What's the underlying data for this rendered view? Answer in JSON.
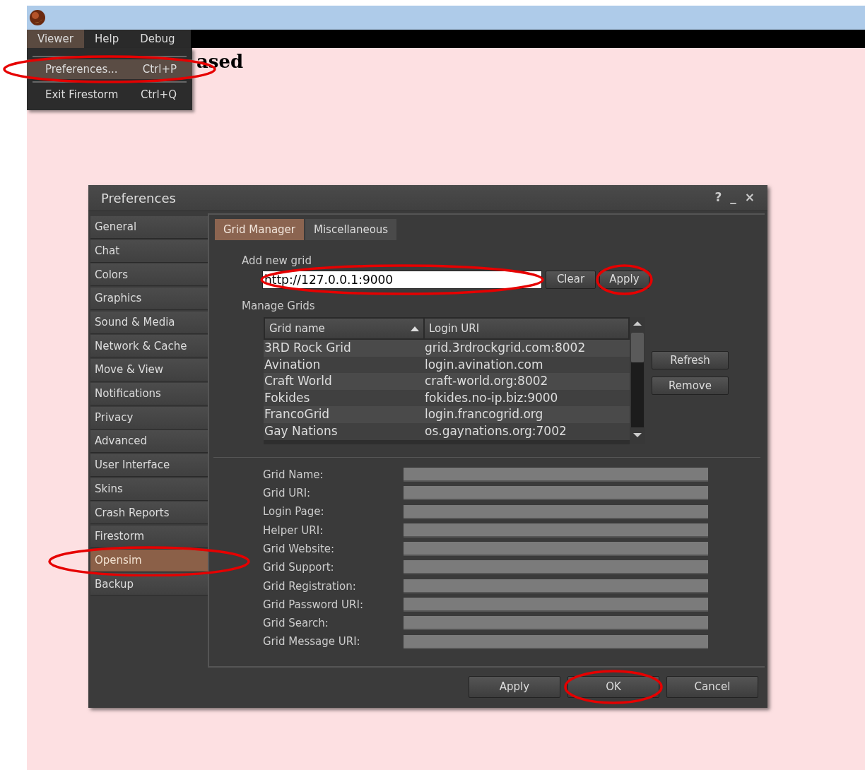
{
  "menu_bar": {
    "items": [
      {
        "label": "Viewer",
        "selected": true
      },
      {
        "label": "Help",
        "selected": false
      },
      {
        "label": "Debug",
        "selected": false
      }
    ]
  },
  "menu": {
    "items": [
      {
        "label": "Preferences...",
        "shortcut": "Ctrl+P",
        "selected": true,
        "circled": true
      },
      {
        "label": "Exit Firestorm",
        "shortcut": "Ctrl+Q",
        "selected": false,
        "circled": false
      }
    ]
  },
  "background_heading": "ased",
  "window": {
    "title": "Preferences",
    "title_buttons": [
      "?",
      "_",
      "×"
    ]
  },
  "sidebar": {
    "items": [
      {
        "label": "General",
        "selected": false,
        "circled": false
      },
      {
        "label": "Chat",
        "selected": false,
        "circled": false
      },
      {
        "label": "Colors",
        "selected": false,
        "circled": false
      },
      {
        "label": "Graphics",
        "selected": false,
        "circled": false
      },
      {
        "label": "Sound & Media",
        "selected": false,
        "circled": false
      },
      {
        "label": "Network & Cache",
        "selected": false,
        "circled": false
      },
      {
        "label": "Move & View",
        "selected": false,
        "circled": false
      },
      {
        "label": "Notifications",
        "selected": false,
        "circled": false
      },
      {
        "label": "Privacy",
        "selected": false,
        "circled": false
      },
      {
        "label": "Advanced",
        "selected": false,
        "circled": false
      },
      {
        "label": "User Interface",
        "selected": false,
        "circled": false
      },
      {
        "label": "Skins",
        "selected": false,
        "circled": false
      },
      {
        "label": "Crash Reports",
        "selected": false,
        "circled": false
      },
      {
        "label": "Firestorm",
        "selected": false,
        "circled": false
      },
      {
        "label": "Opensim",
        "selected": true,
        "circled": true
      },
      {
        "label": "Backup",
        "selected": false,
        "circled": false
      }
    ]
  },
  "tabs": [
    {
      "label": "Grid Manager",
      "selected": true
    },
    {
      "label": "Miscellaneous",
      "selected": false
    }
  ],
  "add_grid": {
    "label": "Add new grid",
    "value": "http://127.0.0.1:9000",
    "circled": true,
    "buttons": [
      {
        "label": "Clear",
        "circled": false
      },
      {
        "label": "Apply",
        "circled": true
      }
    ]
  },
  "manage_grids": {
    "label": "Manage Grids",
    "table": {
      "columns": [
        "Grid name",
        "Login URI"
      ],
      "rows": [
        [
          "3RD Rock Grid",
          "grid.3rdrockgrid.com:8002"
        ],
        [
          "Avination",
          "login.avination.com"
        ],
        [
          "Craft World",
          "craft-world.org:8002"
        ],
        [
          "Fokides",
          "fokides.no-ip.biz:9000"
        ],
        [
          "FrancoGrid",
          "login.francogrid.org"
        ],
        [
          "Gay Nations",
          "os.gaynations.org:7002"
        ]
      ]
    },
    "buttons": [
      "Refresh",
      "Remove"
    ]
  },
  "details": [
    {
      "label": "Grid Name:"
    },
    {
      "label": "Grid URI:"
    },
    {
      "label": "Login Page:"
    },
    {
      "label": "Helper URI:"
    },
    {
      "label": "Grid Website:"
    },
    {
      "label": "Grid Support:"
    },
    {
      "label": "Grid Registration:"
    },
    {
      "label": "Grid Password URI:"
    },
    {
      "label": "Grid Search:"
    },
    {
      "label": "Grid Message URI:"
    }
  ],
  "footer_buttons": [
    {
      "label": "Apply",
      "circled": false
    },
    {
      "label": "OK",
      "circled": true
    },
    {
      "label": "Cancel",
      "circled": false
    }
  ]
}
